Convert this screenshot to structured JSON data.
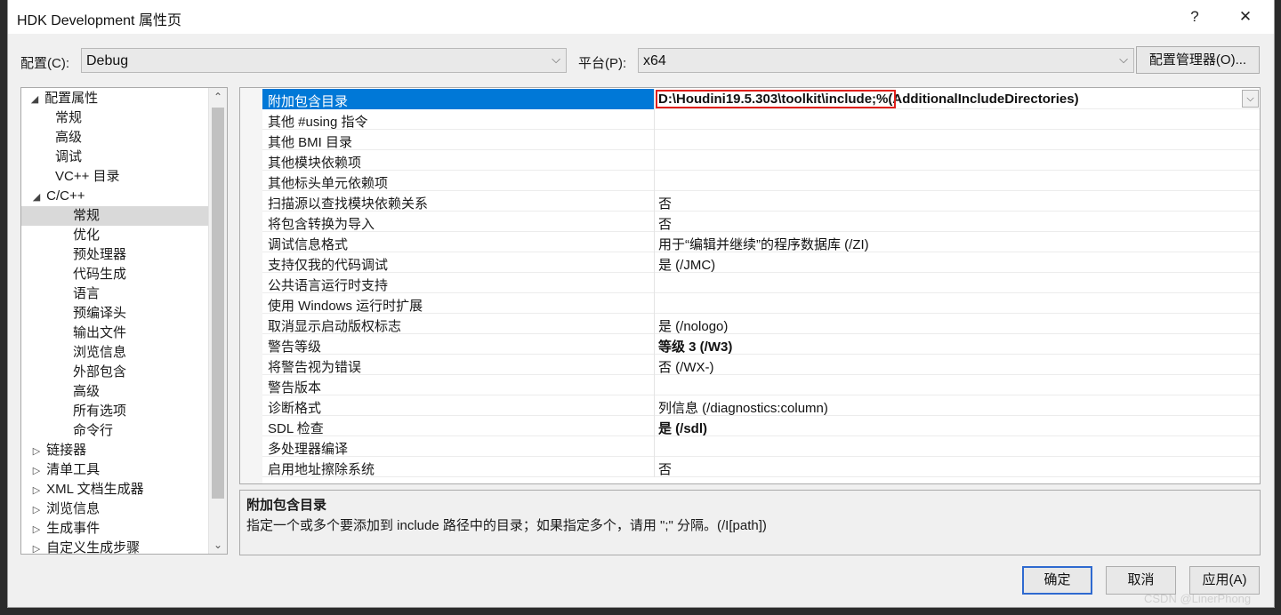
{
  "window": {
    "title": "HDK Development 属性页",
    "help_label": "?",
    "close_label": "✕"
  },
  "config": {
    "config_label": "配置(C):",
    "config_value": "Debug",
    "platform_label": "平台(P):",
    "platform_value": "x64",
    "manager_button": "配置管理器(O)..."
  },
  "tree": {
    "items": [
      {
        "label": "配置属性",
        "expander": "◢",
        "selected": false
      },
      {
        "label": "常规",
        "expander": "",
        "selected": false
      },
      {
        "label": "高级",
        "expander": "",
        "selected": false
      },
      {
        "label": "调试",
        "expander": "",
        "selected": false
      },
      {
        "label": "VC++ 目录",
        "expander": "",
        "selected": false
      },
      {
        "label": "C/C++",
        "expander": "◢",
        "selected": false
      },
      {
        "label": "常规",
        "expander": "",
        "selected": true
      },
      {
        "label": "优化",
        "expander": "",
        "selected": false
      },
      {
        "label": "预处理器",
        "expander": "",
        "selected": false
      },
      {
        "label": "代码生成",
        "expander": "",
        "selected": false
      },
      {
        "label": "语言",
        "expander": "",
        "selected": false
      },
      {
        "label": "预编译头",
        "expander": "",
        "selected": false
      },
      {
        "label": "输出文件",
        "expander": "",
        "selected": false
      },
      {
        "label": "浏览信息",
        "expander": "",
        "selected": false
      },
      {
        "label": "外部包含",
        "expander": "",
        "selected": false
      },
      {
        "label": "高级",
        "expander": "",
        "selected": false
      },
      {
        "label": "所有选项",
        "expander": "",
        "selected": false
      },
      {
        "label": "命令行",
        "expander": "",
        "selected": false
      },
      {
        "label": "链接器",
        "expander": "▷",
        "selected": false
      },
      {
        "label": "清单工具",
        "expander": "▷",
        "selected": false
      },
      {
        "label": "XML 文档生成器",
        "expander": "▷",
        "selected": false
      },
      {
        "label": "浏览信息",
        "expander": "▷",
        "selected": false
      },
      {
        "label": "生成事件",
        "expander": "▷",
        "selected": false
      },
      {
        "label": "自定义生成步骤",
        "expander": "▷",
        "selected": false
      }
    ]
  },
  "properties": {
    "rows": [
      {
        "name": "附加包含目录",
        "value": "",
        "bold": true,
        "selected": true
      },
      {
        "name": "其他 #using 指令",
        "value": "",
        "bold": false,
        "selected": false
      },
      {
        "name": "其他 BMI 目录",
        "value": "",
        "bold": false,
        "selected": false
      },
      {
        "name": "其他模块依赖项",
        "value": "",
        "bold": false,
        "selected": false
      },
      {
        "name": "其他标头单元依赖项",
        "value": "",
        "bold": false,
        "selected": false
      },
      {
        "name": "扫描源以查找模块依赖关系",
        "value": "否",
        "bold": false,
        "selected": false
      },
      {
        "name": "将包含转换为导入",
        "value": "否",
        "bold": false,
        "selected": false
      },
      {
        "name": "调试信息格式",
        "value": "用于“编辑并继续”的程序数据库 (/ZI)",
        "bold": false,
        "selected": false
      },
      {
        "name": "支持仅我的代码调试",
        "value": "是 (/JMC)",
        "bold": false,
        "selected": false
      },
      {
        "name": "公共语言运行时支持",
        "value": "",
        "bold": false,
        "selected": false
      },
      {
        "name": "使用 Windows 运行时扩展",
        "value": "",
        "bold": false,
        "selected": false
      },
      {
        "name": "取消显示启动版权标志",
        "value": "是 (/nologo)",
        "bold": false,
        "selected": false
      },
      {
        "name": "警告等级",
        "value": "等级 3 (/W3)",
        "bold": true,
        "selected": false
      },
      {
        "name": "将警告视为错误",
        "value": "否 (/WX-)",
        "bold": false,
        "selected": false
      },
      {
        "name": "警告版本",
        "value": "",
        "bold": false,
        "selected": false
      },
      {
        "name": "诊断格式",
        "value": "列信息 (/diagnostics:column)",
        "bold": false,
        "selected": false
      },
      {
        "name": "SDL 检查",
        "value": "是 (/sdl)",
        "bold": true,
        "selected": false
      },
      {
        "name": "多处理器编译",
        "value": "",
        "bold": false,
        "selected": false
      },
      {
        "name": "启用地址擦除系统",
        "value": "否",
        "bold": false,
        "selected": false
      }
    ],
    "first_value_highlighted": "D:\\Houdini19.5.303\\toolkit\\include;",
    "first_value_rest": "%(AdditionalIncludeDirectories)"
  },
  "description": {
    "title": "附加包含目录",
    "text": "指定一个或多个要添加到 include 路径中的目录；如果指定多个，请用 \";\" 分隔。(/I[path])"
  },
  "buttons": {
    "ok": "确定",
    "cancel": "取消",
    "apply": "应用(A)"
  },
  "watermark": "CSDN @LinerPhong",
  "colors": {
    "selection": "#0078d7",
    "highlight_box": "#e0201b"
  }
}
